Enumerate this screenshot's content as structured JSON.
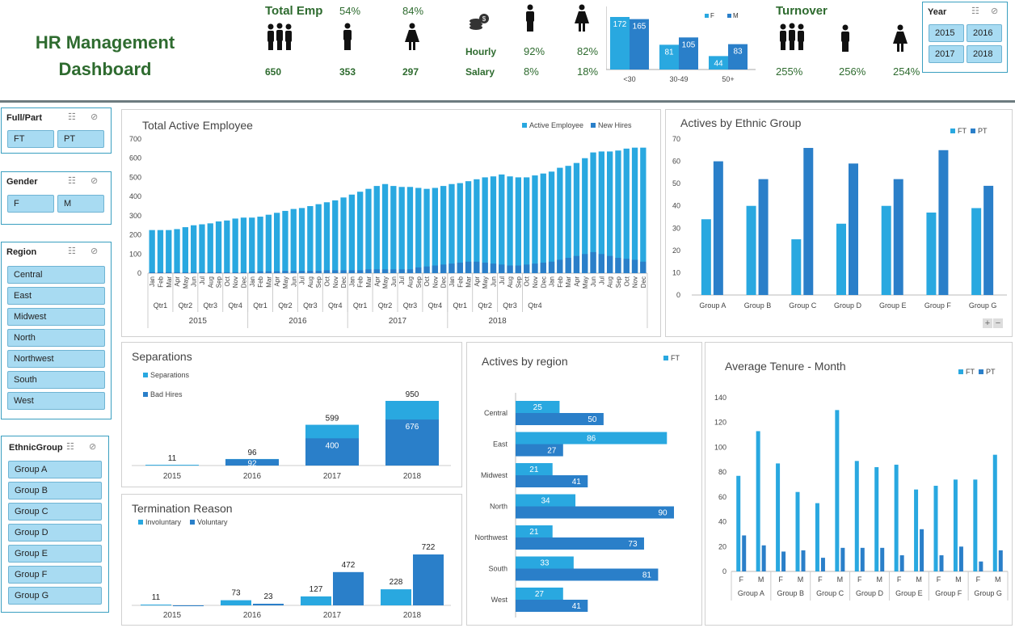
{
  "title": [
    "HR Management",
    "Dashboard"
  ],
  "kpis": {
    "total_emp_label": "Total Emp",
    "total_emp": "650",
    "male_pct": "54%",
    "male": "353",
    "female_pct": "84%",
    "female": "297",
    "hourly_label": "Hourly",
    "salary_label": "Salary",
    "hourly_m": "92%",
    "hourly_f": "82%",
    "salary_m": "8%",
    "salary_f": "18%",
    "turnover_label": "Turnover",
    "turnover_all": "255%",
    "turnover_m": "256%",
    "turnover_f": "254%"
  },
  "age_chart": {
    "legend": [
      "F",
      "M"
    ],
    "categories": [
      "<30",
      "30-49",
      "50+"
    ],
    "F": [
      172,
      81,
      44
    ],
    "M": [
      165,
      105,
      83
    ]
  },
  "slicers": {
    "year": {
      "label": "Year",
      "items": [
        "2015",
        "2016",
        "2017",
        "2018"
      ]
    },
    "fullpart": {
      "label": "Full/Part",
      "items": [
        "FT",
        "PT"
      ]
    },
    "gender": {
      "label": "Gender",
      "items": [
        "F",
        "M"
      ]
    },
    "region": {
      "label": "Region",
      "items": [
        "Central",
        "East",
        "Midwest",
        "North",
        "Northwest",
        "South",
        "West"
      ]
    },
    "ethnic": {
      "label": "EthnicGroup",
      "items": [
        "Group A",
        "Group B",
        "Group C",
        "Group D",
        "Group E",
        "Group F",
        "Group G"
      ]
    }
  },
  "colors": {
    "light": "#29a8e0",
    "dark": "#2a7fc9"
  },
  "chart_data": [
    {
      "type": "bar",
      "title": "Total Active Employee",
      "legend": [
        "Active Employee",
        "New Hires"
      ],
      "ylim": [
        0,
        700
      ],
      "yticks": [
        0,
        100,
        200,
        300,
        400,
        500,
        600,
        700
      ],
      "months": [
        "Jan",
        "Feb",
        "Mar",
        "Apr",
        "May",
        "Jun",
        "Jul",
        "Aug",
        "Sep",
        "Oct",
        "Nov",
        "Dec"
      ],
      "quarters": [
        "Qtr1",
        "Qtr2",
        "Qtr3",
        "Qtr4"
      ],
      "years": [
        "2015",
        "2016",
        "2017",
        "2018"
      ],
      "active": [
        225,
        225,
        225,
        230,
        240,
        250,
        255,
        260,
        270,
        275,
        285,
        290,
        290,
        295,
        305,
        315,
        325,
        335,
        340,
        350,
        360,
        370,
        380,
        395,
        410,
        425,
        440,
        455,
        465,
        455,
        450,
        450,
        445,
        440,
        445,
        455,
        465,
        470,
        480,
        490,
        500,
        505,
        515,
        505,
        500,
        500,
        510,
        520,
        530,
        550,
        560,
        575,
        600,
        630,
        635,
        635,
        640,
        650,
        655,
        655
      ],
      "new_hires": [
        5,
        5,
        5,
        5,
        5,
        5,
        5,
        5,
        5,
        5,
        5,
        5,
        8,
        10,
        10,
        10,
        12,
        12,
        12,
        12,
        12,
        15,
        15,
        15,
        15,
        15,
        20,
        20,
        20,
        20,
        20,
        20,
        30,
        35,
        40,
        45,
        50,
        55,
        60,
        60,
        55,
        50,
        45,
        40,
        40,
        45,
        50,
        55,
        60,
        70,
        80,
        90,
        100,
        110,
        100,
        90,
        80,
        75,
        70,
        60
      ]
    },
    {
      "type": "bar",
      "title": "Actives by Ethnic Group",
      "legend": [
        "FT",
        "PT"
      ],
      "ylim": [
        0,
        70
      ],
      "yticks": [
        0,
        10,
        20,
        30,
        40,
        50,
        60,
        70
      ],
      "categories": [
        "Group A",
        "Group B",
        "Group C",
        "Group D",
        "Group E",
        "Group F",
        "Group G"
      ],
      "FT": [
        34,
        40,
        25,
        32,
        40,
        37,
        39
      ],
      "PT": [
        60,
        52,
        66,
        59,
        52,
        65,
        49
      ]
    },
    {
      "type": "bar",
      "title": "Separations",
      "legend": [
        "Separations",
        "Bad Hires"
      ],
      "categories": [
        "2015",
        "2016",
        "2017",
        "2018"
      ],
      "separations": [
        11,
        96,
        599,
        950
      ],
      "bad_hires": [
        0,
        92,
        400,
        676
      ],
      "labels": [
        "11",
        "96",
        "599",
        "950"
      ],
      "inner": [
        "",
        "92",
        "400",
        "676"
      ]
    },
    {
      "type": "bar",
      "title": "Termination Reason",
      "legend": [
        "Involuntary",
        "Voluntary"
      ],
      "categories": [
        "2015",
        "2016",
        "2017",
        "2018"
      ],
      "involuntary": [
        11,
        73,
        127,
        228
      ],
      "voluntary": [
        0,
        23,
        472,
        722
      ]
    },
    {
      "type": "bar",
      "title": "Actives by region",
      "legend": [
        "FT"
      ],
      "categories": [
        "Central",
        "East",
        "Midwest",
        "North",
        "Northwest",
        "South",
        "West"
      ],
      "FT": [
        25,
        86,
        21,
        34,
        21,
        33,
        27
      ],
      "PT": [
        50,
        27,
        41,
        90,
        73,
        81,
        41
      ]
    },
    {
      "type": "bar",
      "title": "Average Tenure - Month",
      "legend": [
        "FT",
        "PT"
      ],
      "ylim": [
        0,
        140
      ],
      "yticks": [
        0,
        20,
        40,
        60,
        80,
        100,
        120,
        140
      ],
      "categories": [
        "Group A",
        "Group B",
        "Group C",
        "Group D",
        "Group E",
        "Group F",
        "Group G"
      ],
      "sub": [
        "F",
        "M"
      ],
      "F_FT": [
        77,
        87,
        55,
        89,
        86,
        69,
        74
      ],
      "F_PT": [
        29,
        16,
        11,
        19,
        13,
        13,
        8
      ],
      "M_FT": [
        113,
        64,
        130,
        84,
        66,
        74,
        94
      ],
      "M_PT": [
        21,
        17,
        19,
        19,
        34,
        20,
        17
      ]
    }
  ]
}
